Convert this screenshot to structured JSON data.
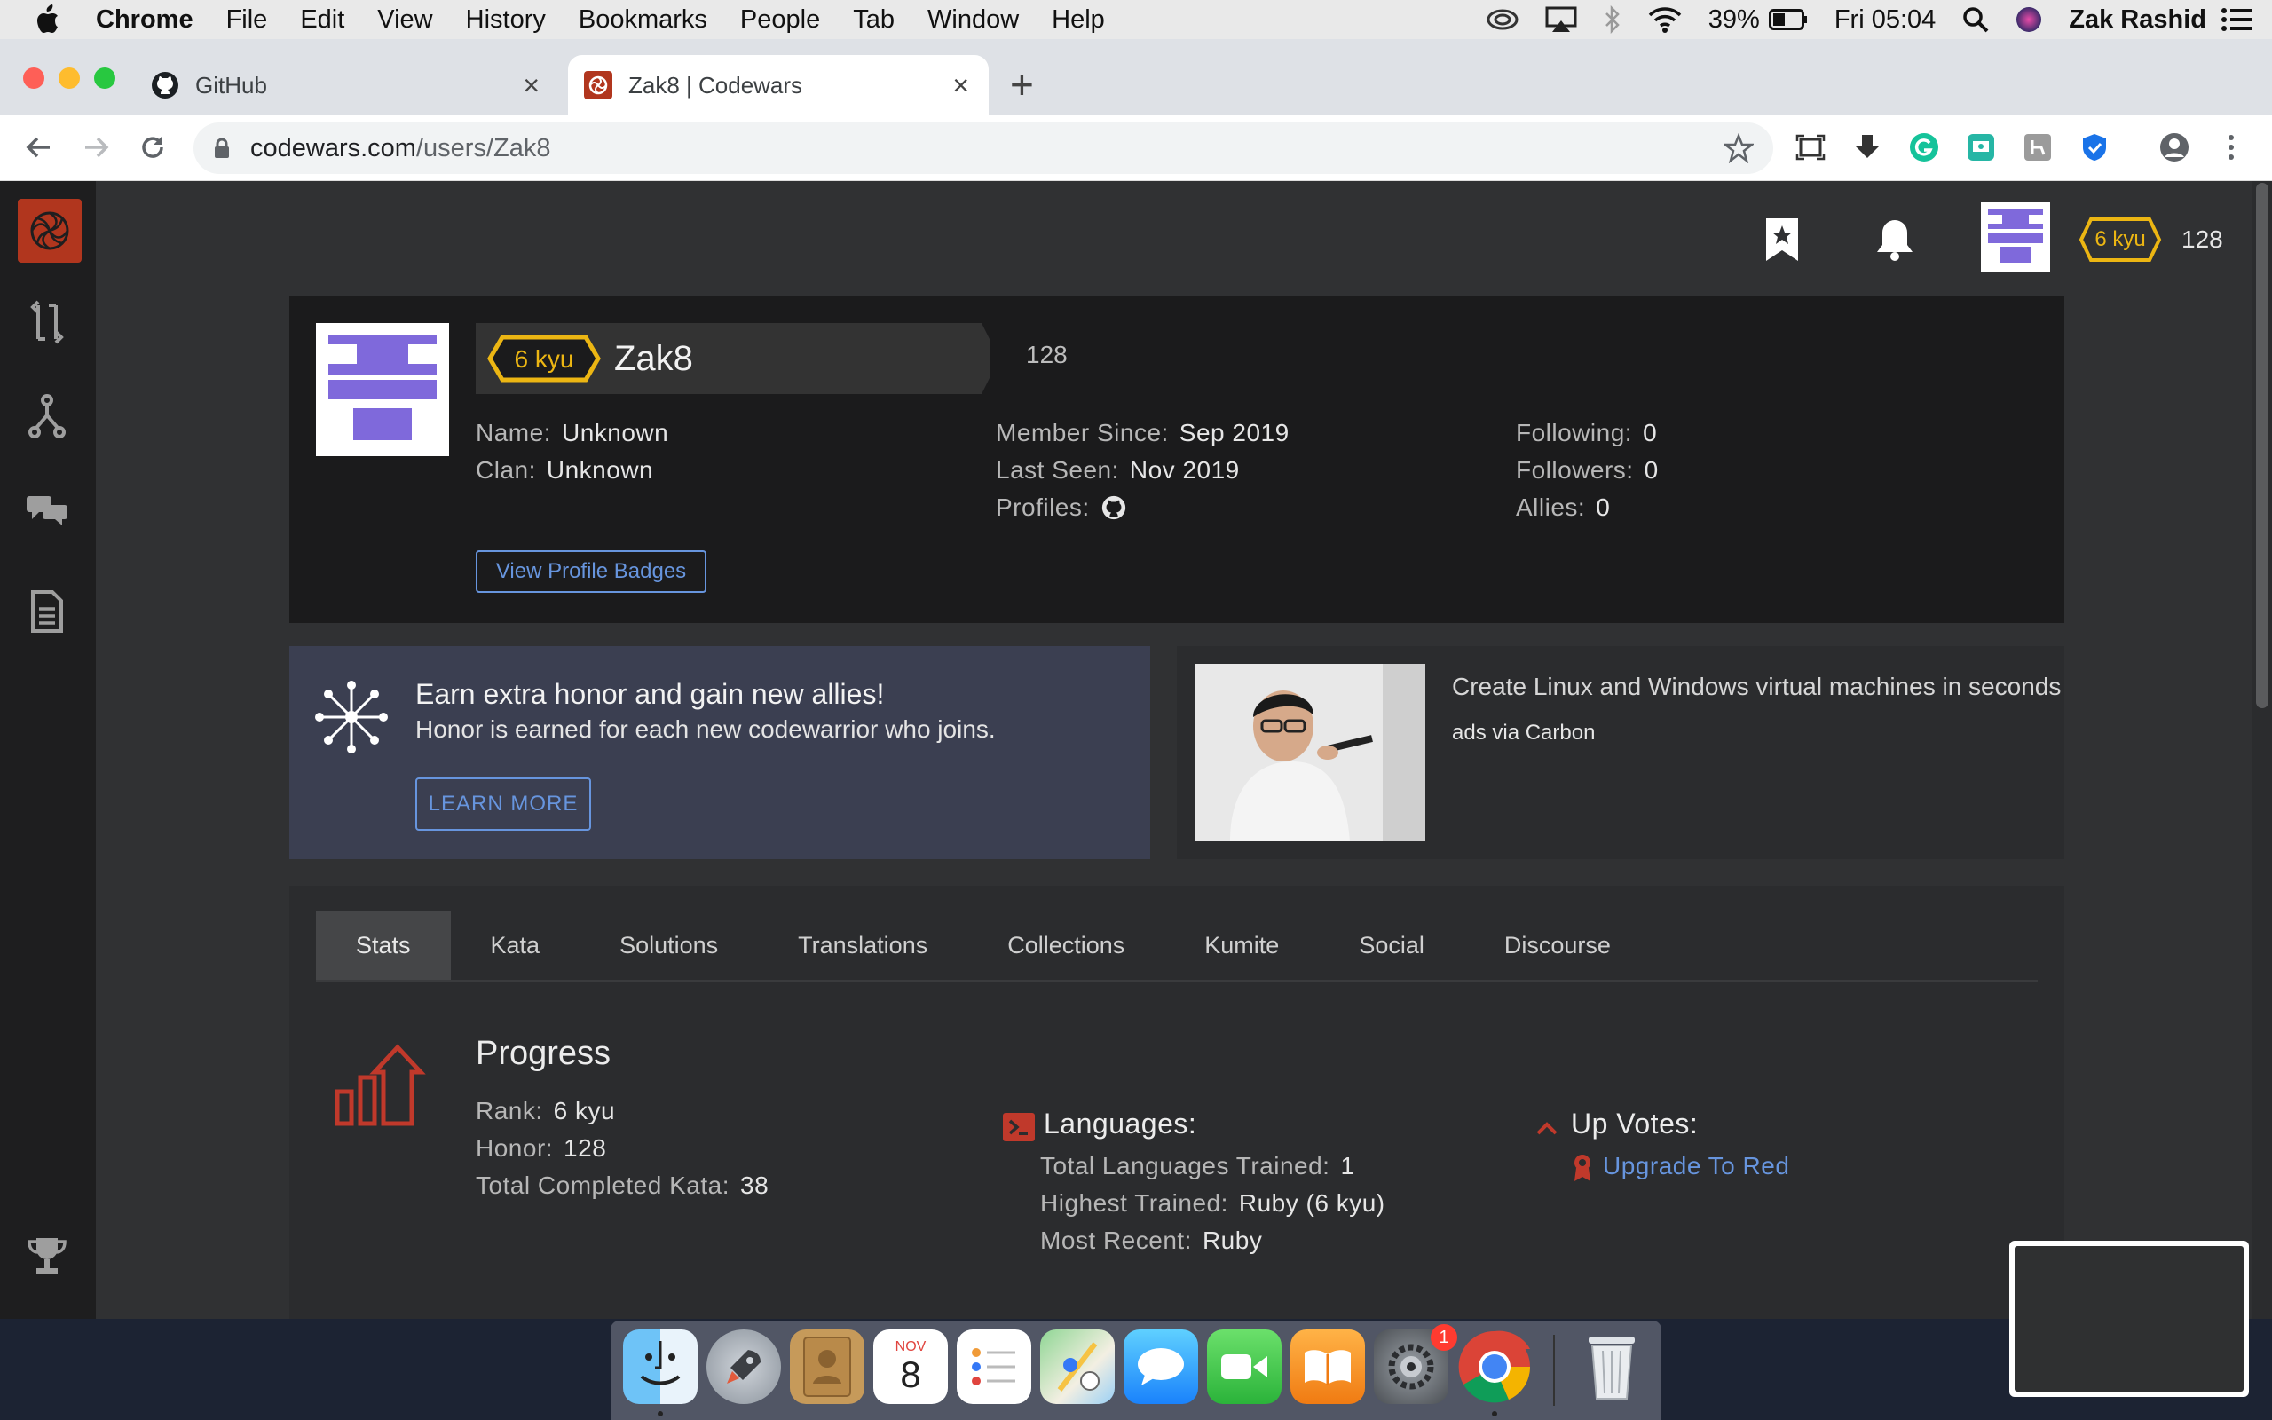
{
  "menubar": {
    "app_name": "Chrome",
    "items": [
      "File",
      "Edit",
      "View",
      "History",
      "Bookmarks",
      "People",
      "Tab",
      "Window",
      "Help"
    ],
    "battery": "39%",
    "clock": "Fri 05:04",
    "user": "Zak Rashid"
  },
  "browser": {
    "tabs": [
      {
        "title": "GitHub",
        "close": "×"
      },
      {
        "title": "Zak8 | Codewars",
        "close": "×"
      }
    ],
    "new_tab": "+",
    "url_host": "codewars.com",
    "url_path": "/users/Zak8"
  },
  "header": {
    "rank": "6 kyu",
    "honor": "128"
  },
  "profile": {
    "rank": "6 kyu",
    "username": "Zak8",
    "honor": "128",
    "name_label": "Name:",
    "name_value": "Unknown",
    "clan_label": "Clan:",
    "clan_value": "Unknown",
    "member_label": "Member Since:",
    "member_value": "Sep 2019",
    "seen_label": "Last Seen:",
    "seen_value": "Nov 2019",
    "profiles_label": "Profiles:",
    "following_label": "Following:",
    "following_value": "0",
    "followers_label": "Followers:",
    "followers_value": "0",
    "allies_label": "Allies:",
    "allies_value": "0",
    "badges_button": "View Profile Badges"
  },
  "promo": {
    "title": "Earn extra honor and gain new allies!",
    "subtitle": "Honor is earned for each new codewarrior who joins.",
    "button": "LEARN MORE"
  },
  "ad": {
    "text": "Create Linux and Windows virtual machines in seconds",
    "via": "ads via Carbon"
  },
  "profile_tabs": [
    "Stats",
    "Kata",
    "Solutions",
    "Translations",
    "Collections",
    "Kumite",
    "Social",
    "Discourse"
  ],
  "progress": {
    "title": "Progress",
    "rank_label": "Rank:",
    "rank_value": "6 kyu",
    "honor_label": "Honor:",
    "honor_value": "128",
    "completed_label": "Total Completed Kata:",
    "completed_value": "38"
  },
  "languages": {
    "title": "Languages:",
    "trained_label": "Total Languages Trained:",
    "trained_value": "1",
    "highest_label": "Highest Trained:",
    "highest_value": "Ruby (6 kyu)",
    "recent_label": "Most Recent:",
    "recent_value": "Ruby"
  },
  "upvotes": {
    "title": "Up Votes:",
    "link": "Upgrade To Red"
  },
  "dock": {
    "calendar_month": "NOV",
    "calendar_day": "8",
    "settings_badge": "1"
  },
  "colors": {
    "accent_blue": "#6795de",
    "kyu_yellow": "#ecb613",
    "codewars_red": "#b1361e",
    "avatar_purple": "#7f69db"
  }
}
